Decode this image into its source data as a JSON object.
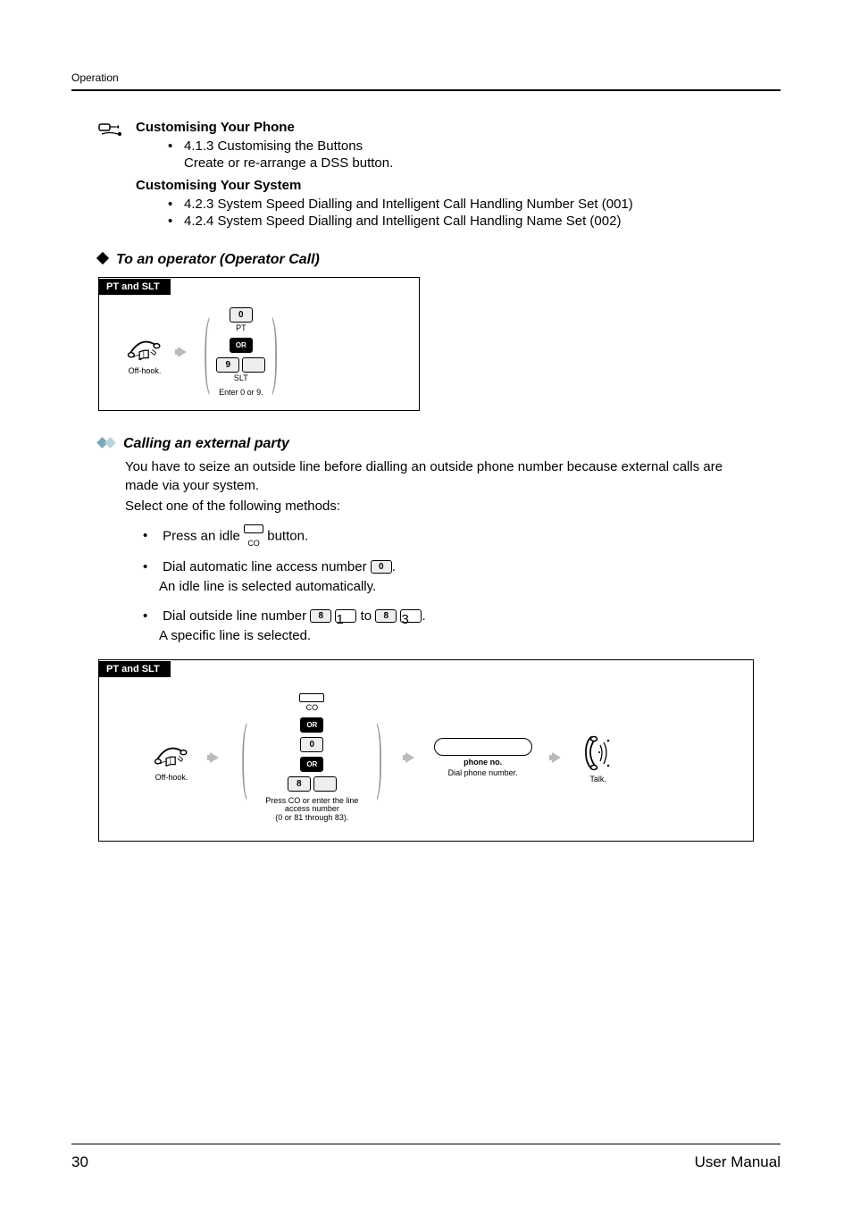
{
  "header": {
    "section": "Operation"
  },
  "customise": {
    "phone_title": "Customising Your Phone",
    "phone_item": "4.1.3   Customising the Buttons",
    "phone_note": "Create or re-arrange a DSS button.",
    "system_title": "Customising Your System",
    "system_items": [
      "4.2.3   System Speed Dialling and Intelligent Call Handling Number Set (001)",
      "4.2.4   System Speed Dialling and Intelligent Call Handling Name Set (002)"
    ]
  },
  "operator": {
    "heading": "To an operator (Operator Call)",
    "tab": "PT and SLT",
    "offhook_label": "Off-hook.",
    "key0": "0",
    "key0_label": "PT",
    "or": "OR",
    "key9": "9",
    "key9_label": "SLT",
    "enter_label": "Enter 0 or 9."
  },
  "external": {
    "heading": "Calling an external party",
    "p1": "You have to seize an outside line before dialling an outside phone number because external calls are made via your system.",
    "p2": "Select one of the following methods:",
    "b1a": "Press an idle ",
    "co_label": "CO",
    "b1b": " button.",
    "b2a": "Dial automatic line access number ",
    "key0": "0",
    "b2b": ".",
    "b2c": "An idle line is selected automatically.",
    "b3a": "Dial outside line number ",
    "key8": "8",
    "key1": "1",
    "to": " to ",
    "key3": "3",
    "b3b": ".",
    "b3c": "A specific line is selected."
  },
  "diagram2": {
    "tab": "PT and SLT",
    "offhook": "Off-hook.",
    "co": "CO",
    "or": "OR",
    "key0": "0",
    "key8": "8",
    "blank": "",
    "press_co": "Press CO or enter the line\naccess number\n(0 or 81 through 83).",
    "dial_label": "Dial phone number.",
    "phone_no": "phone no.",
    "talk": "Talk."
  },
  "footer": {
    "page": "30",
    "manual": "User Manual"
  }
}
